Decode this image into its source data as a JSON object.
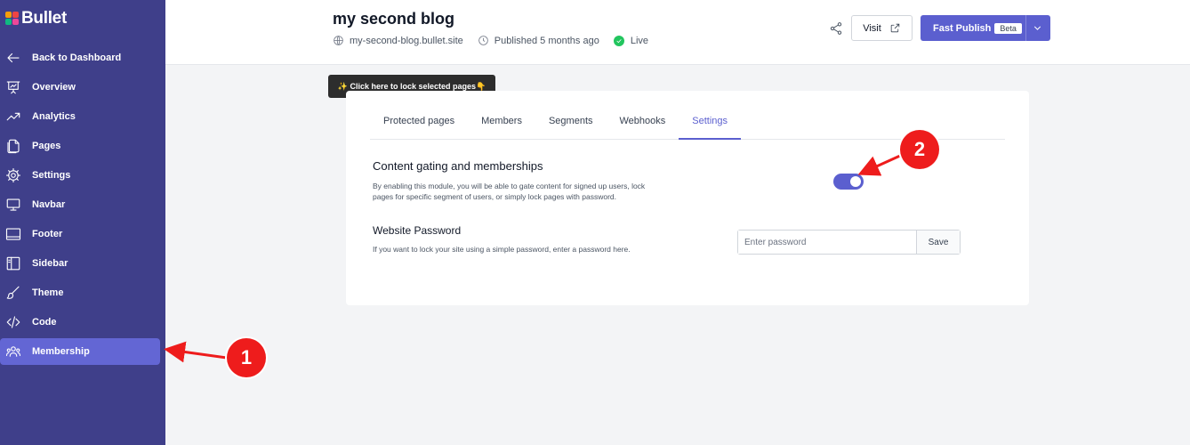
{
  "brand": {
    "name": "Bullet"
  },
  "sidebar": {
    "items": [
      {
        "label": "Back to Dashboard",
        "icon": "arrow-left-icon"
      },
      {
        "label": "Overview",
        "icon": "presentation-chart-icon"
      },
      {
        "label": "Analytics",
        "icon": "trending-up-icon"
      },
      {
        "label": "Pages",
        "icon": "pages-icon"
      },
      {
        "label": "Settings",
        "icon": "gear-icon"
      },
      {
        "label": "Navbar",
        "icon": "monitor-icon"
      },
      {
        "label": "Footer",
        "icon": "footer-icon"
      },
      {
        "label": "Sidebar",
        "icon": "sidebar-layout-icon"
      },
      {
        "label": "Theme",
        "icon": "paintbrush-icon"
      },
      {
        "label": "Code",
        "icon": "code-icon"
      },
      {
        "label": "Membership",
        "icon": "users-icon",
        "active": true
      }
    ]
  },
  "header": {
    "title": "my second blog",
    "domain": "my-second-blog.bullet.site",
    "published": "Published 5 months ago",
    "status": "Live",
    "visit_label": "Visit",
    "publish_label": "Fast Publish",
    "beta_label": "Beta"
  },
  "tooltip": {
    "text": "✨ Click here to lock selected pages👇"
  },
  "tabs": [
    {
      "label": "Protected pages"
    },
    {
      "label": "Members"
    },
    {
      "label": "Segments"
    },
    {
      "label": "Webhooks"
    },
    {
      "label": "Settings",
      "active": true
    }
  ],
  "gating": {
    "title": "Content gating and memberships",
    "desc_line1": "By enabling this module, you will be able to gate content for signed up users, lock",
    "desc_line2": "pages for specific segment of users, or simply lock pages with password.",
    "enabled": true
  },
  "password": {
    "title": "Website Password",
    "desc": "If you want to lock your site using a simple password, enter a password here.",
    "placeholder": "Enter password",
    "value": "",
    "save_label": "Save"
  },
  "annotations": {
    "marker1": "1",
    "marker2": "2",
    "color": "#ee1c1c"
  },
  "colors": {
    "sidebar_bg": "#3f3f8a",
    "accent": "#5b5fcf",
    "live": "#22c55e"
  }
}
